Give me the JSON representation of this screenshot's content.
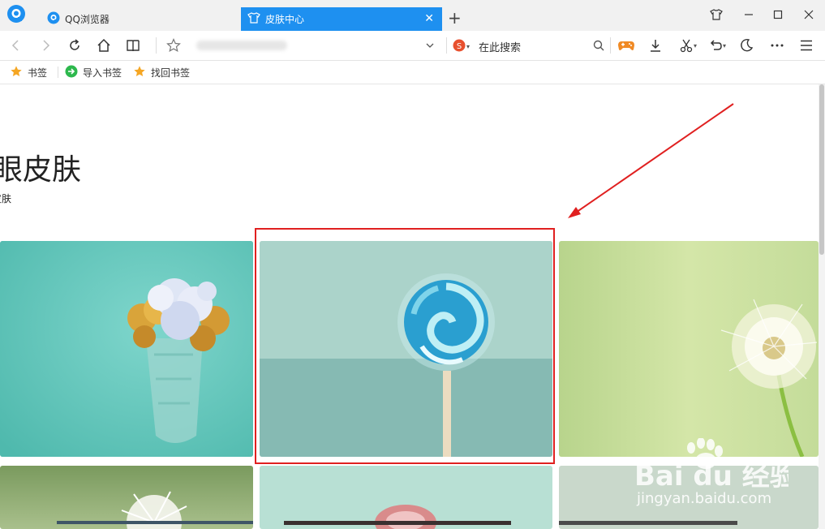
{
  "tabs": [
    {
      "label": "QQ浏览器"
    },
    {
      "label": "皮肤中心"
    }
  ],
  "toolbar": {
    "search_text": "在此搜索"
  },
  "bookmarks": [
    {
      "label": "书签"
    },
    {
      "label": "导入书签"
    },
    {
      "label": "找回书签"
    }
  ],
  "page": {
    "heading": "眼皮肤",
    "subtitle": "皮肤"
  },
  "watermark": {
    "brand": "Bai du 经验",
    "url": "jingyan.baidu.com"
  },
  "colors": {
    "tab_active": "#1e90f0",
    "annotation_red": "#e02020",
    "star_orange": "#f5a623",
    "import_green": "#2db84d"
  }
}
